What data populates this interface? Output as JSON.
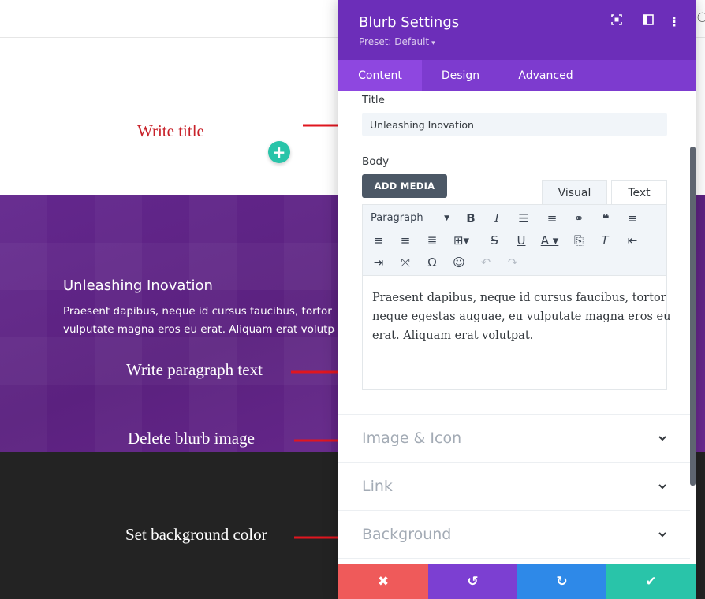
{
  "annotations": {
    "write_title": "Write title",
    "write_paragraph": "Write paragraph text",
    "delete_image": "Delete blurb image",
    "set_background": "Set background color"
  },
  "preview": {
    "blurb_title": "Unleashing Inovation",
    "blurb_body_lines": [
      "Praesent dapibus, neque id cursus faucibus, tortor ne",
      "vulputate magna eros eu erat. Aliquam erat volutpat."
    ],
    "add_button": "+"
  },
  "panel": {
    "title": "Blurb Settings",
    "preset": "Preset: Default",
    "tabs": [
      {
        "label": "Content",
        "active": true
      },
      {
        "label": "Design",
        "active": false
      },
      {
        "label": "Advanced",
        "active": false
      }
    ],
    "fields": {
      "title_label": "Title",
      "title_value": "Unleashing Inovation",
      "body_label": "Body",
      "add_media": "ADD MEDIA",
      "editor_tabs": [
        "Visual",
        "Text"
      ],
      "format": "Paragraph",
      "body_lines": [
        "Praesent dapibus, neque id cursus faucibus, tortor",
        "neque egestas auguae, eu vulputate magna eros eu",
        "erat. Aliquam erat volutpat."
      ]
    },
    "sections": [
      "Image & Icon",
      "Link",
      "Background"
    ],
    "footer": {
      "discard": "✖",
      "undo": "↺",
      "redo": "↻",
      "save": "✔"
    }
  },
  "colors": {
    "panel_header": "#6c2eb9",
    "tab_bar": "#7d3bcf",
    "active_tab": "#8e47e0",
    "purple_section": "#5b217f",
    "dark_section": "#232323",
    "arrow": "#e0161f",
    "discard": "#ef5a5a",
    "undo": "#7c3fd2",
    "redo": "#2e89e8",
    "save": "#29c4a9"
  },
  "icons": [
    "expand-icon",
    "sidebar-toggle-icon",
    "more-options-icon",
    "chevron-down-icon",
    "arrow-icon"
  ]
}
